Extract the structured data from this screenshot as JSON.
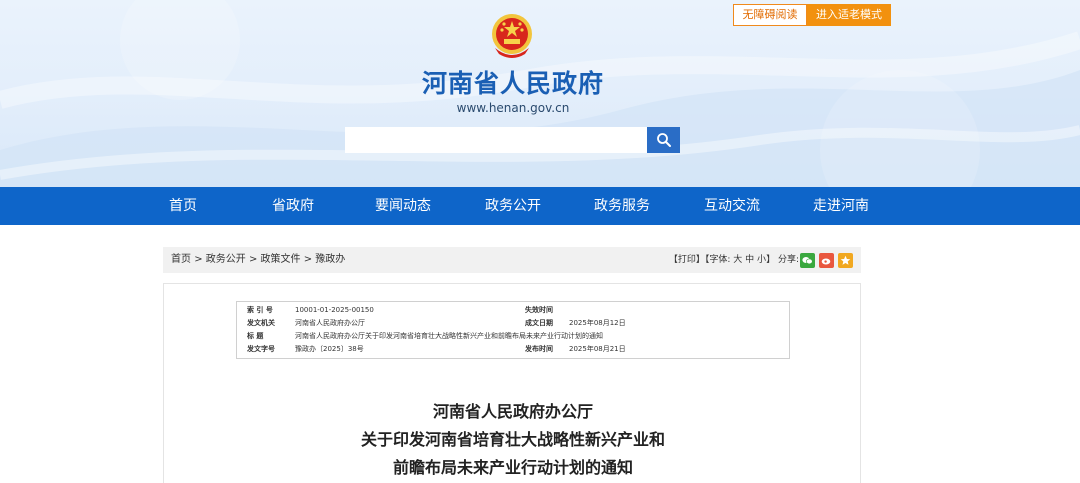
{
  "header": {
    "barrier_free_label": "无障碍阅读",
    "elder_mode_label": "进入适老模式",
    "site_title": "河南省人民政府",
    "site_url": "www.henan.gov.cn",
    "search_placeholder": "",
    "search_icon": "search-icon"
  },
  "nav": {
    "items": [
      {
        "label": "首页"
      },
      {
        "label": "省政府"
      },
      {
        "label": "要闻动态"
      },
      {
        "label": "政务公开"
      },
      {
        "label": "政务服务"
      },
      {
        "label": "互动交流"
      },
      {
        "label": "走进河南"
      }
    ]
  },
  "breadcrumb": {
    "items": [
      "首页",
      "政务公开",
      "政策文件",
      "豫政办"
    ],
    "separator": ">"
  },
  "tools": {
    "print": "【打印】",
    "font_prefix": "【字体:",
    "font_large": "大",
    "font_medium": "中",
    "font_small": "小",
    "font_suffix": "】",
    "share_label": "分享:",
    "share_icons": [
      "wechat-icon",
      "weibo-icon",
      "favorite-icon"
    ]
  },
  "meta": {
    "index_label": "索 引 号",
    "index_value": "10001-01-2025-00150",
    "expire_label": "失效时间",
    "expire_value": "",
    "issuer_label": "发文机关",
    "issuer_value": "河南省人民政府办公厅",
    "created_label": "成文日期",
    "created_value": "2025年08月12日",
    "title_label": "标  题",
    "title_value": "河南省人民政府办公厅关于印发河南省培育壮大战略性新兴产业和前瞻布局未来产业行动计划的通知",
    "doc_no_label": "发文字号",
    "doc_no_value": "豫政办〔2025〕38号",
    "publish_label": "发布时间",
    "publish_value": "2025年08月21日"
  },
  "document": {
    "title_line1": "河南省人民政府办公厅",
    "title_line2": "关于印发河南省培育壮大战略性新兴产业和",
    "title_line3": "前瞻布局未来产业行动计划的通知"
  },
  "colors": {
    "brand_blue": "#0e65c9",
    "title_blue": "#1a5fb4",
    "accent_orange": "#f2910f"
  }
}
